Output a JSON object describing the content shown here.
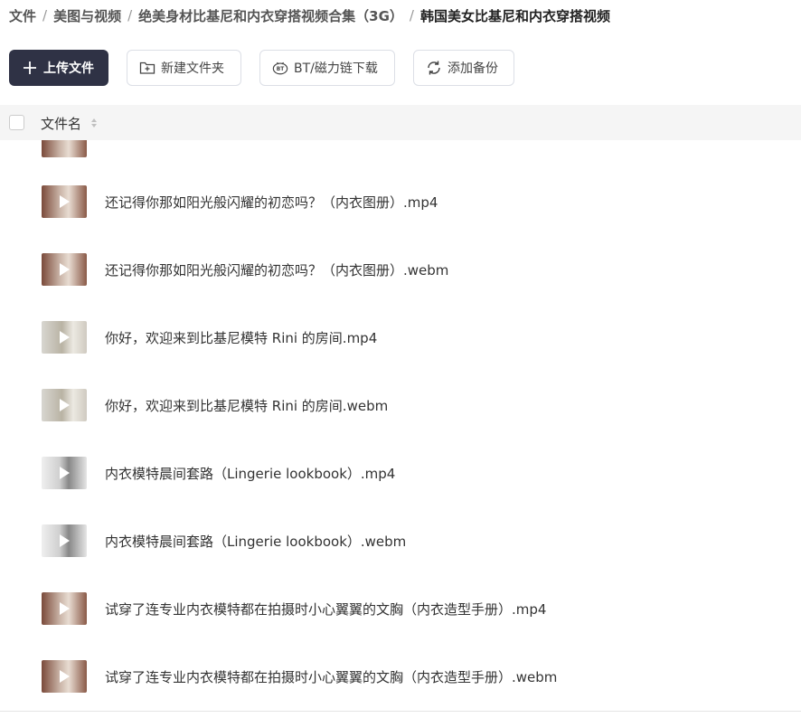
{
  "breadcrumb": {
    "items": [
      "文件",
      "美图与视频",
      "绝美身材比基尼和内衣穿搭视频合集（3G）",
      "韩国美女比基尼和内衣穿搭视频"
    ],
    "separator": "/"
  },
  "toolbar": {
    "upload_label": "上传文件",
    "new_folder_label": "新建文件夹",
    "bt_label": "BT/磁力链下载",
    "backup_label": "添加备份",
    "bt_icon_text": "BT"
  },
  "list_header": {
    "name_label": "文件名"
  },
  "files": [
    {
      "name": "还记得你那如阳光般闪耀的初恋吗？（内衣图册）.mp4"
    },
    {
      "name": "还记得你那如阳光般闪耀的初恋吗？（内衣图册）.webm"
    },
    {
      "name": "你好，欢迎来到比基尼模特 Rini 的房间.mp4"
    },
    {
      "name": "你好，欢迎来到比基尼模特 Rini 的房间.webm"
    },
    {
      "name": "内衣模特晨间套路（Lingerie lookbook）.mp4"
    },
    {
      "name": "内衣模特晨间套路（Lingerie lookbook）.webm"
    },
    {
      "name": "试穿了连专业内衣模特都在拍摄时小心翼翼的文胸（内衣造型手册）.mp4"
    },
    {
      "name": "试穿了连专业内衣模特都在拍摄时小心翼翼的文胸（内衣造型手册）.webm"
    }
  ],
  "icons": {
    "file_thumbnail": "video-thumbnail",
    "play": "play-icon"
  },
  "colors": {
    "primary_button": "#2f3245",
    "header_bg": "#f5f5f5"
  }
}
